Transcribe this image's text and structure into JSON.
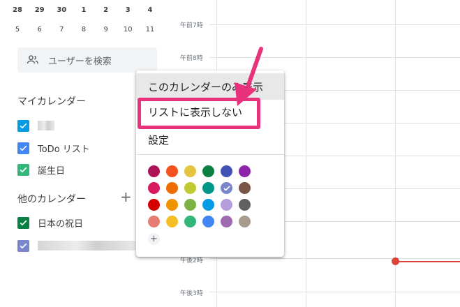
{
  "mini_calendar": {
    "row1": [
      "28",
      "29",
      "30",
      "1",
      "2",
      "3",
      "4"
    ],
    "row2": [
      "5",
      "6",
      "7",
      "8",
      "9",
      "10",
      "11"
    ]
  },
  "search": {
    "placeholder": "ユーザーを検索"
  },
  "my_calendars": {
    "title": "マイカレンダー",
    "items": [
      {
        "label": "",
        "color": "#039be5"
      },
      {
        "label": "ToDo リスト",
        "color": "#4285f4"
      },
      {
        "label": "誕生日",
        "color": "#33b679"
      }
    ]
  },
  "other_calendars": {
    "title": "他のカレンダー",
    "add_icon": "+",
    "items": [
      {
        "label": "日本の祝日",
        "color": "#0b8043"
      },
      {
        "label": "",
        "color": "#7986cb"
      }
    ]
  },
  "time_labels": [
    "午前7時",
    "午前8時",
    "午後2時",
    "午後3時"
  ],
  "menu": {
    "items": [
      "このカレンダーのみ表示",
      "リストに表示しない",
      "設定"
    ],
    "add_color_label": "+",
    "colors": [
      [
        "#ad1457",
        "#f4511e",
        "#e4c441",
        "#0b8043",
        "#3f51b5",
        "#8e24aa"
      ],
      [
        "#d81b60",
        "#ef6c00",
        "#c0ca33",
        "#009688",
        "#7986cb",
        "#795548"
      ],
      [
        "#d50000",
        "#f09300",
        "#7cb342",
        "#039be5",
        "#b39ddb",
        "#616161"
      ],
      [
        "#e67c73",
        "#f6bf26",
        "#33b679",
        "#4285f4",
        "#9e69af",
        "#a79b8e"
      ]
    ],
    "selected_color": "#7986cb"
  },
  "annotation_color": "#e8327c"
}
